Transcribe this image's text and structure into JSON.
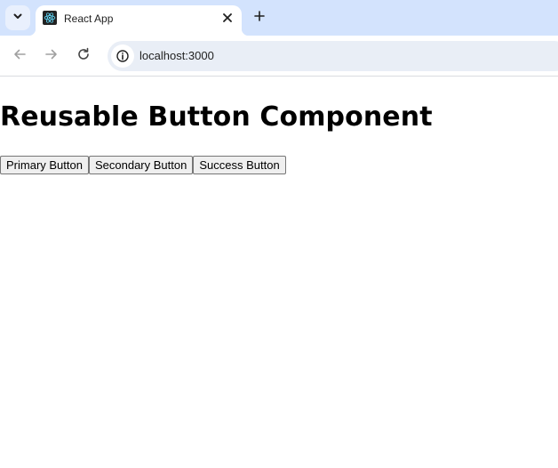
{
  "browser": {
    "tab": {
      "title": "React App"
    },
    "address_bar": {
      "url": "localhost:3000"
    }
  },
  "page": {
    "heading": "Reusable Button Component",
    "buttons": [
      {
        "label": "Primary Button"
      },
      {
        "label": "Secondary Button"
      },
      {
        "label": "Success Button"
      }
    ]
  },
  "icons": {
    "tab_search": "chevron-down-icon",
    "favicon": "react-logo-icon",
    "tab_close": "close-icon",
    "new_tab": "plus-icon",
    "back": "arrow-left-icon",
    "forward": "arrow-right-icon",
    "reload": "reload-icon",
    "site_info": "info-icon"
  },
  "colors": {
    "tabstrip_bg": "#d3e3fd",
    "omnibox_bg": "#e9eef6",
    "react_logo": "#61dafb"
  }
}
